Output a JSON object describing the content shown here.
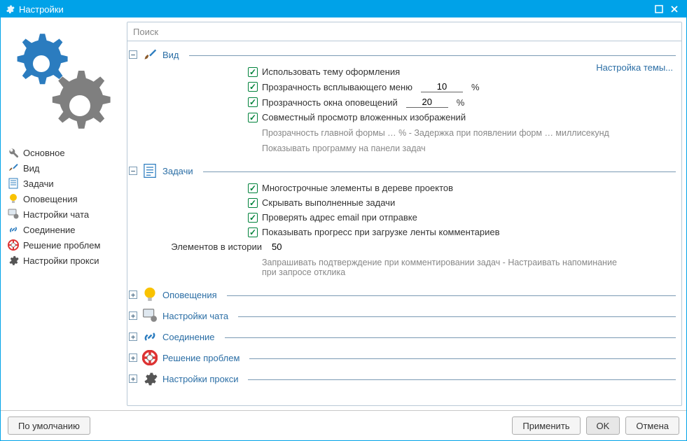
{
  "window": {
    "title": "Настройки"
  },
  "search": {
    "placeholder": "Поиск"
  },
  "sidebar": [
    {
      "label": "Основное",
      "icon": "wrench"
    },
    {
      "label": "Вид",
      "icon": "brush"
    },
    {
      "label": "Задачи",
      "icon": "document"
    },
    {
      "label": "Оповещения",
      "icon": "bulb"
    },
    {
      "label": "Настройки чата",
      "icon": "chat"
    },
    {
      "label": "Соединение",
      "icon": "link"
    },
    {
      "label": "Решение проблем",
      "icon": "lifebuoy"
    },
    {
      "label": "Настройки прокси",
      "icon": "gear"
    }
  ],
  "sections": {
    "vid": {
      "title": "Вид",
      "theme_link": "Настройка темы...",
      "opts": {
        "use_theme": {
          "label": "Использовать тему оформления",
          "checked": true
        },
        "popup_opacity": {
          "label": "Прозрачность всплывающего меню",
          "value": "10",
          "suffix": "%",
          "checked": true
        },
        "notify_opacity": {
          "label": "Прозрачность окна оповещений",
          "value": "20",
          "suffix": "%",
          "checked": true
        },
        "joint_view": {
          "label": "Совместный просмотр вложенных изображений",
          "checked": true
        }
      },
      "grey1": "Прозрачность главной формы … % -  Задержка при появлении форм … миллисекунд",
      "grey2": "Показывать программу на панели задач"
    },
    "tasks": {
      "title": "Задачи",
      "opts": {
        "multiline": {
          "label": "Многострочные элементы в дереве проектов",
          "checked": true
        },
        "hide_done": {
          "label": "Скрывать выполненные задачи",
          "checked": true
        },
        "check_email": {
          "label": "Проверять адрес email при отправке",
          "checked": true
        },
        "show_progress": {
          "label": "Показывать прогресс при загрузке ленты комментариев",
          "checked": true
        }
      },
      "history_label": "Элементов в истории",
      "history_value": "50",
      "grey1": "Запрашивать подтверждение при комментировании задач -  Настраивать напоминание при запросе отклика"
    },
    "collapsed": {
      "notify": "Оповещения",
      "chat": "Настройки чата",
      "connection": "Соединение",
      "troubleshoot": "Решение проблем",
      "proxy": "Настройки прокси"
    }
  },
  "footer": {
    "defaults": "По умолчанию",
    "apply": "Применить",
    "ok": "OK",
    "cancel": "Отмена"
  }
}
